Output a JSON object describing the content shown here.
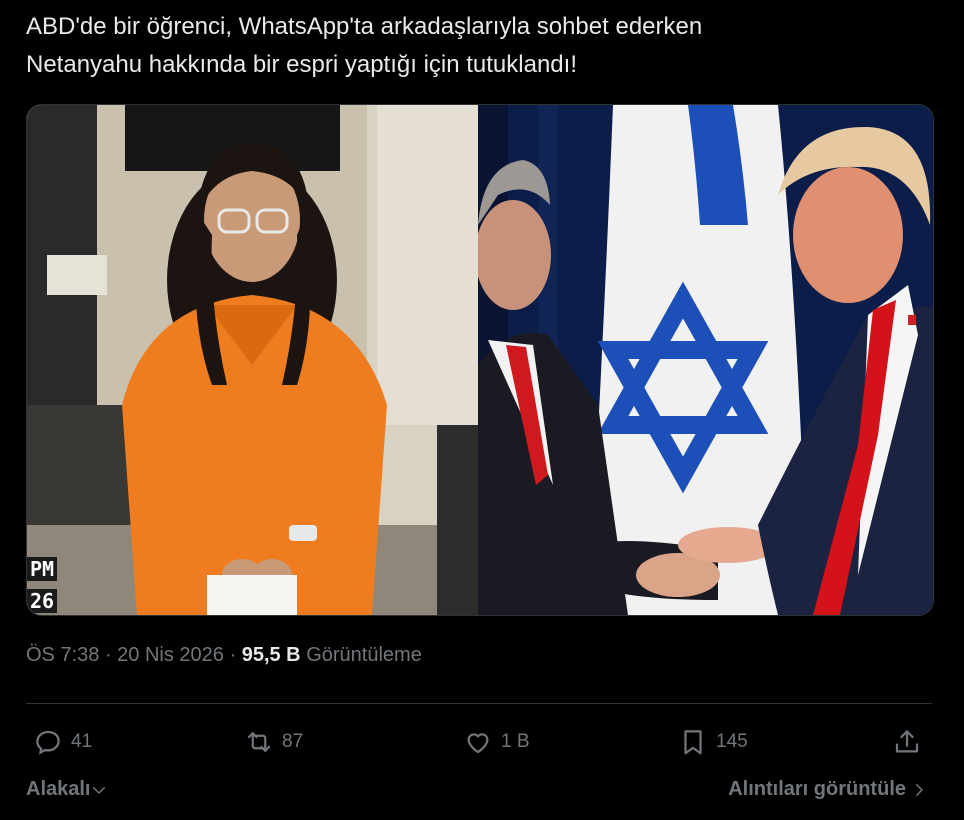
{
  "tweet": {
    "text": "ABD'de bir öğrenci, WhatsApp'ta arkadaşlarıyla sohbet ederken\nNetanyahu hakkında bir espri yaptığı için tutuklandı!"
  },
  "media": {
    "left_overlay_time": "PM",
    "left_overlay_num": "26"
  },
  "meta": {
    "time": "ÖS 7:38",
    "separator": " · ",
    "date": "20 Nis 2026",
    "views_count": "95,5 B",
    "views_label": "Görüntüleme"
  },
  "actions": {
    "reply_count": "41",
    "retweet_count": "87",
    "like_count": "1 B",
    "bookmark_count": "145"
  },
  "footer": {
    "sort_label": "Alakalı",
    "quotes_label": "Alıntıları görüntüle"
  },
  "colors": {
    "background": "#000000",
    "text": "#e7e9ea",
    "muted": "#71767b",
    "divider": "#2f3336"
  },
  "icons": [
    "reply-icon",
    "retweet-icon",
    "like-icon",
    "bookmark-icon",
    "share-icon",
    "chevron-down-icon",
    "chevron-right-icon"
  ]
}
